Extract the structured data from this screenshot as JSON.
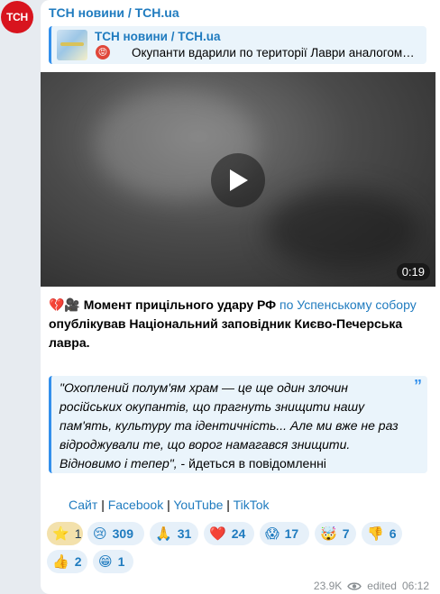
{
  "avatar": {
    "text": "ТСН"
  },
  "channel": {
    "name": "ТСН новини / TCH.ua"
  },
  "reply": {
    "name": "ТСН новини / TCH.ua",
    "emoji": "😡",
    "text": "Окупанти вдарили по території Лаври аналогом…"
  },
  "video": {
    "duration": "0:19"
  },
  "caption": {
    "emoji": "💔🎥",
    "bold1": "Момент прицільного удару РФ",
    "link": "по Успенському собору",
    "bold2": "опублікував Національний заповідник Києво-Печерська лавра."
  },
  "quote": {
    "text": "\"Охоплений полум'ям храм — це ще один злочин російських окупантів, що прагнуть знищити нашу пам'ять, культуру та ідентичність... Але ми вже не раз відроджували те, що ворог намагався знищити. Відновимо і тепер\",",
    "tail": " - йдеться в повідомленні",
    "icon": "”"
  },
  "links": [
    {
      "label": "Сайт"
    },
    {
      "label": "Facebook"
    },
    {
      "label": "YouTube"
    },
    {
      "label": "TikTok"
    }
  ],
  "reactions": [
    {
      "emoji": "⭐",
      "count": "1",
      "selected": true
    },
    {
      "emoji": "😢",
      "count": "309"
    },
    {
      "emoji": "🙏",
      "count": "31"
    },
    {
      "emoji": "❤️",
      "count": "24"
    },
    {
      "emoji": "😱",
      "count": "17"
    },
    {
      "emoji": "🤯",
      "count": "7"
    },
    {
      "emoji": "👎",
      "count": "6"
    },
    {
      "emoji": "👍",
      "count": "2"
    },
    {
      "emoji": "😁",
      "count": "1"
    }
  ],
  "meta": {
    "views": "23.9K",
    "edited": "edited",
    "time": "06:12"
  },
  "colors": {
    "accent": "#1f7bbf",
    "quote_bar": "#3390ec",
    "avatar_bg": "#d8141e",
    "background": "#e7ebf0"
  }
}
